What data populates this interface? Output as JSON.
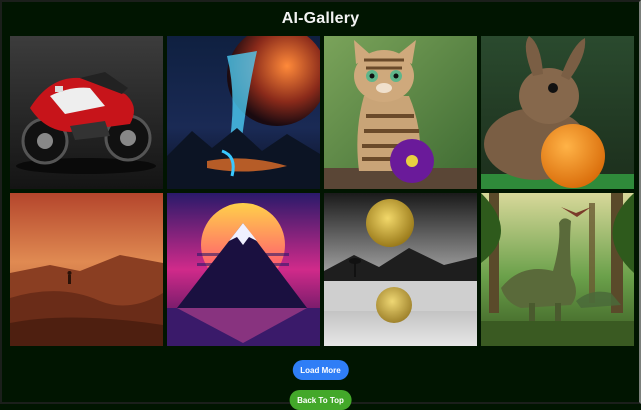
{
  "header": {
    "title": "AI-Gallery"
  },
  "gallery": {
    "images": [
      {
        "subject": "red-white motorcycle"
      },
      {
        "subject": "fantasy planet and crystal landscape"
      },
      {
        "subject": "tabby kitten with purple flower"
      },
      {
        "subject": "rabbit with orange"
      },
      {
        "subject": "martian desert landscape"
      },
      {
        "subject": "synthwave mountain sunset"
      },
      {
        "subject": "golden moon over misty lake"
      },
      {
        "subject": "dinosaurs in jungle"
      }
    ]
  },
  "buttons": {
    "load_more": "Load More",
    "back_to_top": "Back To Top"
  },
  "colors": {
    "background": "#011501",
    "load_more": "#2f7ef6",
    "back_to_top": "#43a82a"
  }
}
